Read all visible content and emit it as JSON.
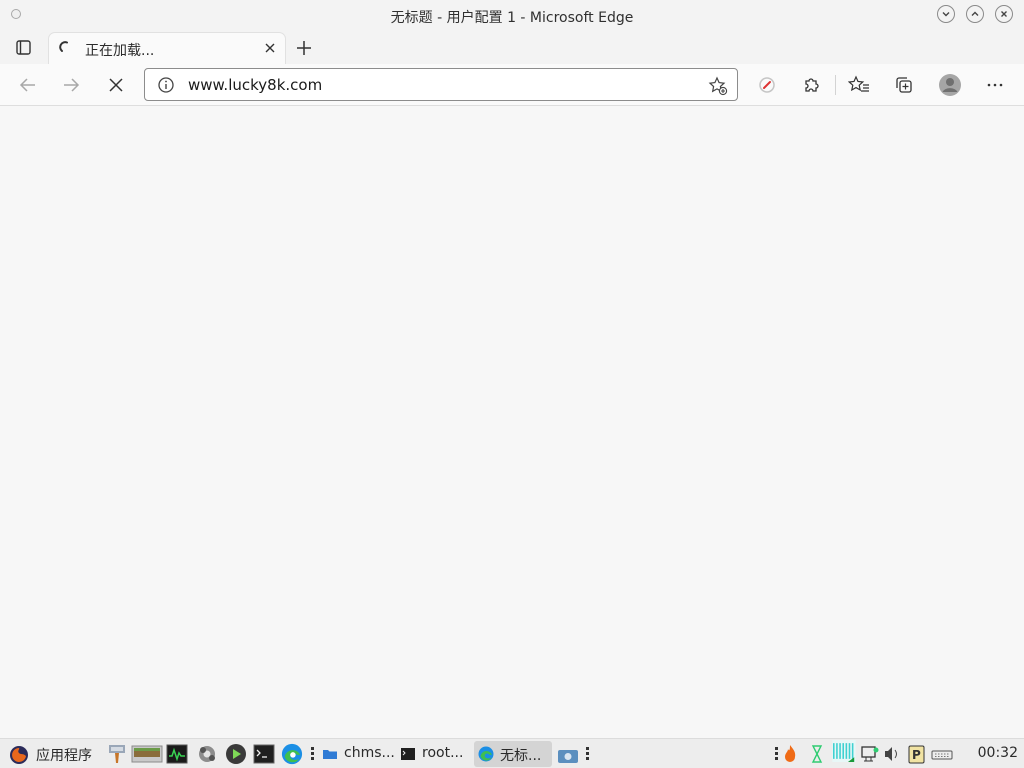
{
  "window": {
    "title": "无标题 - 用户配置 1 - Microsoft Edge"
  },
  "tab": {
    "label": "正在加载..."
  },
  "address": {
    "url": "www.lucky8k.com"
  },
  "taskbar": {
    "menu_label": "应用程序",
    "tasks": [
      {
        "label": "chms...",
        "icon": "folder-icon"
      },
      {
        "label": "root...",
        "icon": "terminal-icon"
      },
      {
        "label": "无标...",
        "icon": "edge-icon",
        "active": true
      }
    ],
    "clock": "00:32"
  },
  "colors": {
    "accent": "#0078d4",
    "edge_blue": "#1b8fe5",
    "edge_green": "#3fbf4f"
  }
}
